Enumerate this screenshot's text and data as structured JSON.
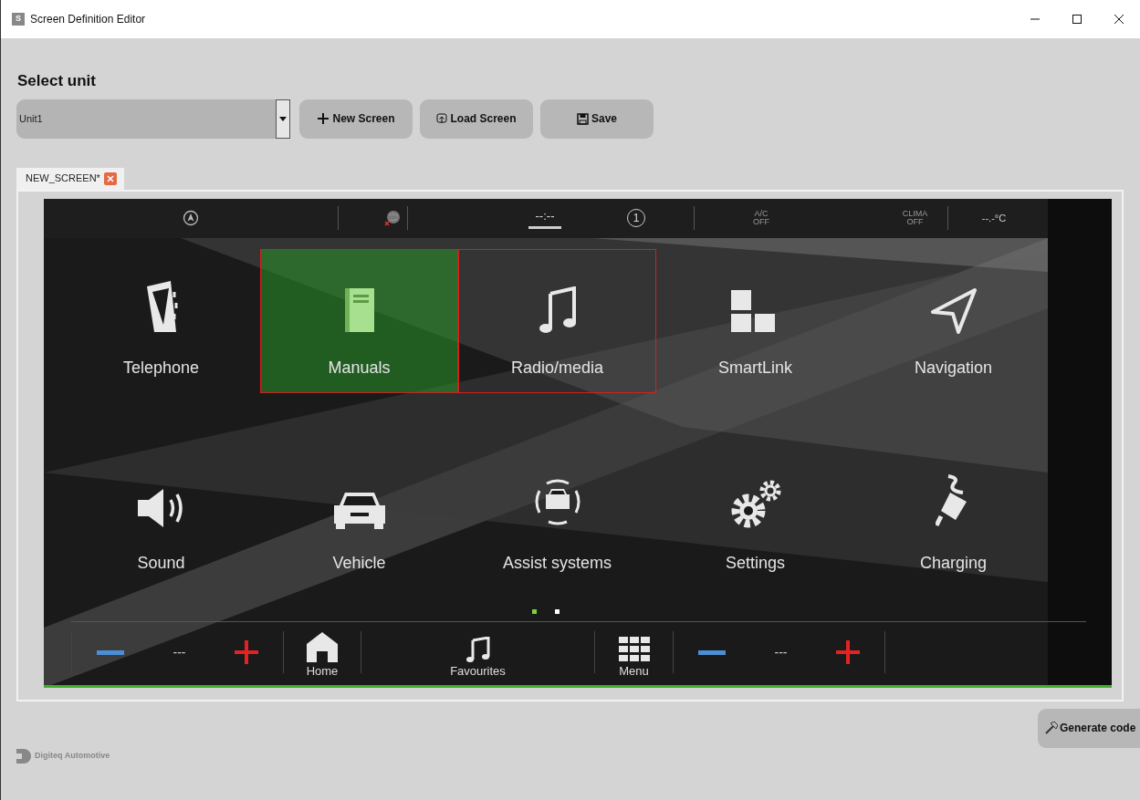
{
  "window": {
    "title": "Screen Definition Editor",
    "app_icon": "S"
  },
  "unit_section": {
    "heading": "Select unit",
    "unit_select": {
      "value": "Unit1"
    }
  },
  "toolbar_buttons": [
    {
      "label": "New Screen"
    },
    {
      "label": "Load Screen"
    },
    {
      "label": "Save"
    }
  ],
  "tabs": [
    {
      "label": "NEW_SCREEN*",
      "selected": true,
      "closable": true
    }
  ],
  "screen": {
    "status_bar": [
      {
        "kind": "navigation"
      },
      {
        "kind": "online"
      },
      {
        "kind": "clock",
        "text": "--:--"
      },
      {
        "kind": "profile",
        "text": "1"
      },
      {
        "kind": "ac",
        "label": "A/C",
        "state": "OFF"
      },
      {
        "kind": "clima",
        "label": "CLIMA",
        "state": "OFF"
      },
      {
        "kind": "temperature",
        "text": "--.-°C"
      }
    ],
    "apps": [
      {
        "label": "Telephone",
        "selected": false,
        "outlined": false
      },
      {
        "label": "Manuals",
        "selected": true,
        "outlined": true
      },
      {
        "label": "Radio/media",
        "selected": false,
        "outlined": true
      },
      {
        "label": "SmartLink",
        "selected": false,
        "outlined": false
      },
      {
        "label": "Navigation",
        "selected": false,
        "outlined": false
      },
      {
        "label": "Sound",
        "selected": false,
        "outlined": false
      },
      {
        "label": "Vehicle",
        "selected": false,
        "outlined": false
      },
      {
        "label": "Assist systems",
        "selected": false,
        "outlined": false
      },
      {
        "label": "Settings",
        "selected": false,
        "outlined": false
      },
      {
        "label": "Charging",
        "selected": false,
        "outlined": false
      }
    ],
    "pages": [
      {
        "selected": true
      },
      {
        "selected": false
      }
    ],
    "bottom_bar": [
      {
        "kind": "volume",
        "value": "---"
      },
      {
        "kind": "shortcut",
        "label": "Home"
      },
      {
        "kind": "shortcut",
        "label": "Favourites"
      },
      {
        "kind": "shortcut",
        "label": "Menu"
      },
      {
        "kind": "volume",
        "value": "---"
      }
    ]
  },
  "footer": {
    "brand": "Digiteq Automotive",
    "generate_button": "Generate code"
  }
}
